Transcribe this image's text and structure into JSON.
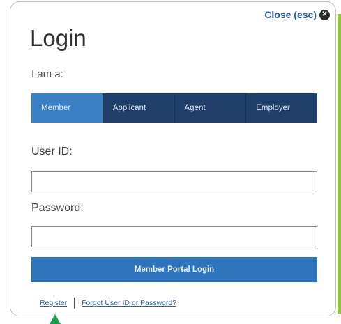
{
  "close": {
    "label": "Close (esc)",
    "icon": "close-icon"
  },
  "title": "Login",
  "role_prompt": "I am a:",
  "tabs": [
    {
      "label": "Member",
      "active": true
    },
    {
      "label": "Applicant",
      "active": false
    },
    {
      "label": "Agent",
      "active": false
    },
    {
      "label": "Employer",
      "active": false
    }
  ],
  "user_id": {
    "label": "User ID:",
    "value": "",
    "placeholder": ""
  },
  "password": {
    "label": "Password:",
    "value": "",
    "placeholder": ""
  },
  "login_button": "Member Portal Login",
  "links": {
    "register": "Register",
    "forgot": "Forgot User ID or Password?"
  },
  "colors": {
    "active_tab": "#3b7fc4",
    "inactive_tab": "#1f3f6a",
    "button": "#2e74bd",
    "link": "#2b5f9e",
    "pointer": "#1a9a4a",
    "accent_edge": "#8ec63f"
  }
}
